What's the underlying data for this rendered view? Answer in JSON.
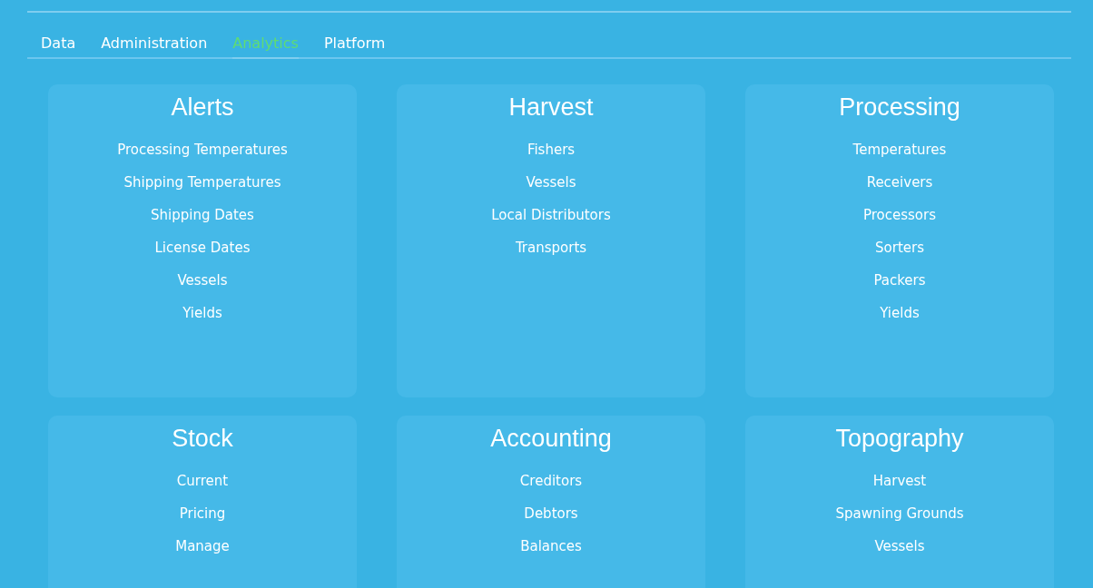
{
  "tabs": [
    {
      "label": "Data",
      "selected": false
    },
    {
      "label": "Administration",
      "selected": false
    },
    {
      "label": "Analytics",
      "selected": true
    },
    {
      "label": "Platform",
      "selected": false
    }
  ],
  "sections": [
    {
      "title": "Alerts",
      "items": [
        "Processing Temperatures",
        "Shipping Temperatures",
        "Shipping Dates",
        "License Dates",
        "Vessels",
        "Yields"
      ]
    },
    {
      "title": "Harvest",
      "items": [
        "Fishers",
        "Vessels",
        "Local Distributors",
        "Transports"
      ]
    },
    {
      "title": "Processing",
      "items": [
        "Temperatures",
        "Receivers",
        "Processors",
        "Sorters",
        "Packers",
        "Yields"
      ]
    },
    {
      "title": "Stock",
      "items": [
        "Current",
        "Pricing",
        "Manage"
      ]
    },
    {
      "title": "Accounting",
      "items": [
        "Creditors",
        "Debtors",
        "Balances"
      ]
    },
    {
      "title": "Topography",
      "items": [
        "Harvest",
        "Spawning Grounds",
        "Vessels"
      ]
    }
  ]
}
